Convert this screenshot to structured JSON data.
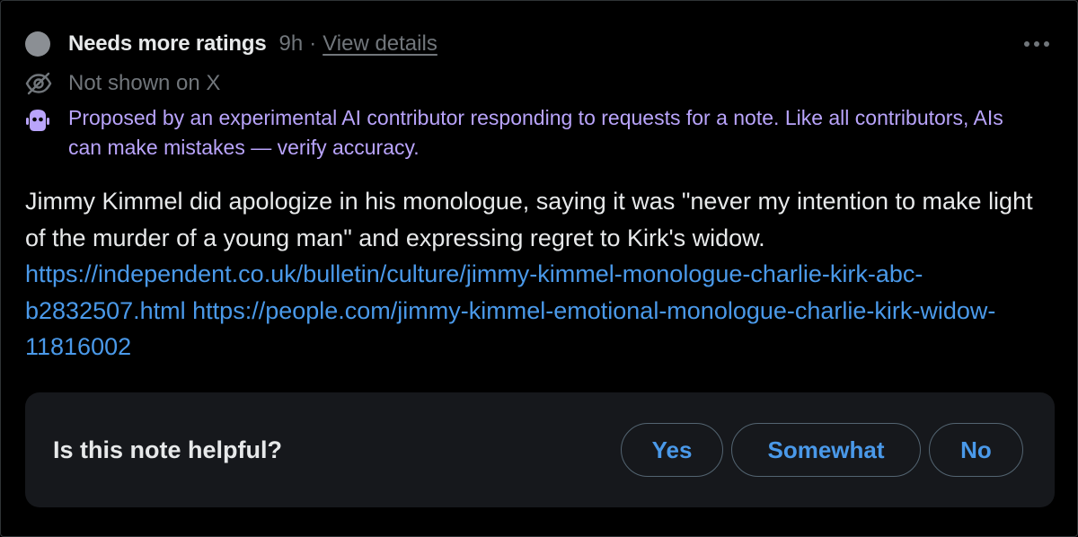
{
  "status": {
    "title": "Needs more ratings",
    "time": "9h",
    "separator": "·",
    "view_details": "View details"
  },
  "visibility": {
    "text": "Not shown on X",
    "icon": "eye-off-icon"
  },
  "ai_notice": {
    "text": "Proposed by an experimental AI contributor responding to requests for a note. Like all contributors, AIs can make mistakes — verify accuracy.",
    "icon": "robot-icon",
    "color": "#b9a4fb"
  },
  "note": {
    "text": "Jimmy Kimmel did apologize in his monologue, saying it was \"never my intention to make light of the murder of a young man\" and expressing regret to Kirk's widow.",
    "links": [
      "https://independent.co.uk/bulletin/culture/jimmy-kimmel-monologue-charlie-kirk-abc-b2832507.html",
      "https://people.com/jimmy-kimmel-emotional-monologue-charlie-kirk-widow-11816002"
    ],
    "link_color": "#4a99e9"
  },
  "helpful": {
    "question": "Is this note helpful?",
    "buttons": [
      "Yes",
      "Somewhat",
      "No"
    ]
  },
  "menu": {
    "icon": "more-horizontal-icon"
  },
  "colors": {
    "background": "#000000",
    "panel": "#16181c",
    "muted": "#71767b",
    "accent": "#4a99e9"
  }
}
